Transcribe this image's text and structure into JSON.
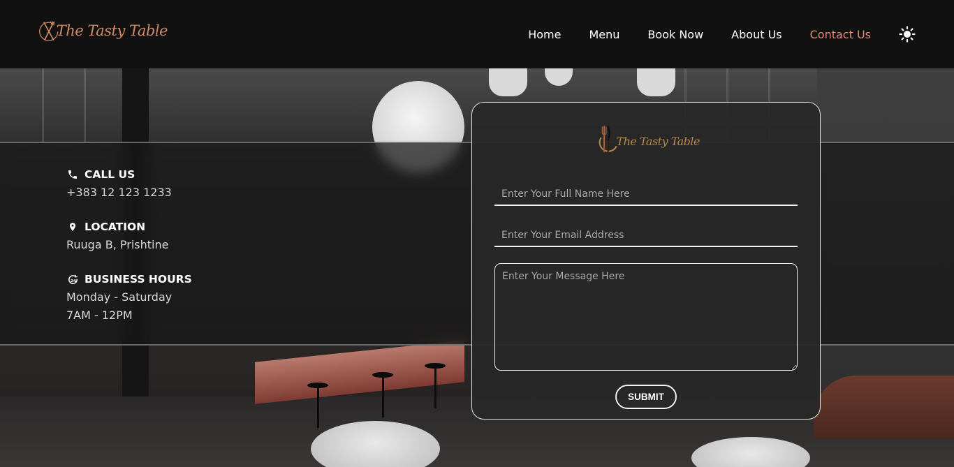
{
  "brand": {
    "name": "The Tasty Table",
    "accent": "#d08a63",
    "card_accent": "#b5894b"
  },
  "nav": {
    "items": [
      {
        "label": "Home",
        "active": false
      },
      {
        "label": "Menu",
        "active": false
      },
      {
        "label": "Book Now",
        "active": false
      },
      {
        "label": "About Us",
        "active": false
      },
      {
        "label": "Contact Us",
        "active": true
      }
    ],
    "active_color": "#e0897a",
    "theme_toggle_icon": "sun-icon"
  },
  "info": {
    "call": {
      "icon": "phone-icon",
      "title": "CALL US",
      "value": "+383 12 123 1233"
    },
    "location": {
      "icon": "location-pin-icon",
      "title": "LOCATION",
      "value": "Ruuga B, Prishtine"
    },
    "hours": {
      "icon": "clock-24-icon",
      "title": "BUSINESS HOURS",
      "days": "Monday - Saturday",
      "time": "7AM - 12PM"
    }
  },
  "form": {
    "name_placeholder": "Enter Your Full Name Here",
    "email_placeholder": "Enter Your Email Address",
    "message_placeholder": "Enter Your Message Here",
    "submit_label": "SUBMIT"
  }
}
